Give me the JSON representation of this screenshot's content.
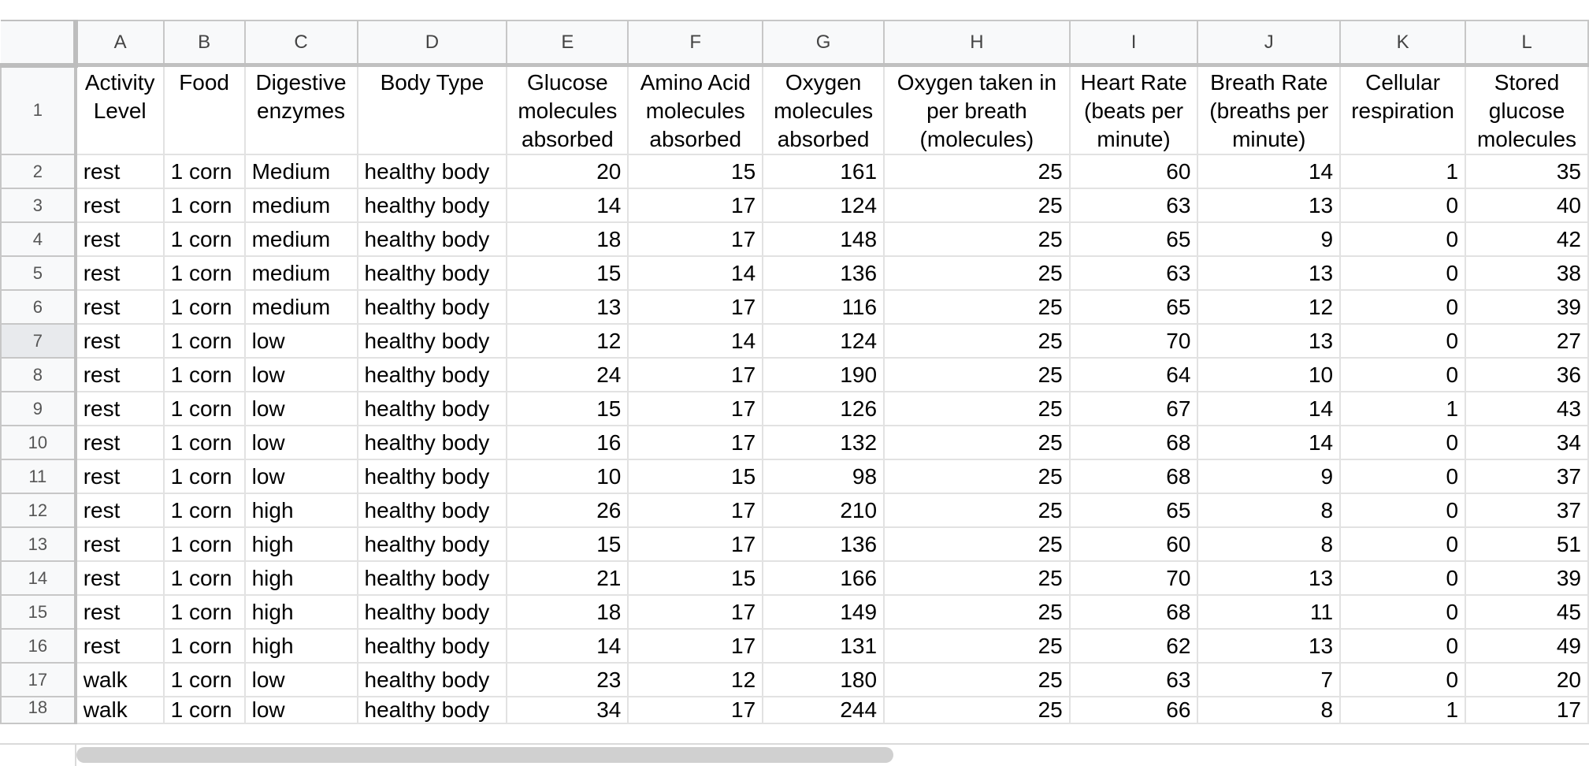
{
  "columns": [
    "A",
    "B",
    "C",
    "D",
    "E",
    "F",
    "G",
    "H",
    "I",
    "J",
    "K",
    "L"
  ],
  "header_row_number": "1",
  "headers": [
    "Activity Level",
    "Food",
    "Digestive enzymes",
    "Body Type",
    "Glucose molecules absorbed",
    "Amino Acid molecules absorbed",
    "Oxygen molecules absorbed",
    "Oxygen taken in per breath (molecules)",
    "Heart Rate (beats per minute)",
    "Breath Rate (breaths per minute)",
    "Cellular respiration",
    "Stored glucose molecules"
  ],
  "rows": [
    {
      "n": "2",
      "cells": [
        "rest",
        "1 corn",
        "Medium",
        "healthy body",
        "20",
        "15",
        "161",
        "25",
        "60",
        "14",
        "1",
        "35"
      ]
    },
    {
      "n": "3",
      "cells": [
        "rest",
        "1 corn",
        "medium",
        "healthy body",
        "14",
        "17",
        "124",
        "25",
        "63",
        "13",
        "0",
        "40"
      ]
    },
    {
      "n": "4",
      "cells": [
        "rest",
        "1 corn",
        "medium",
        "healthy body",
        "18",
        "17",
        "148",
        "25",
        "65",
        "9",
        "0",
        "42"
      ]
    },
    {
      "n": "5",
      "cells": [
        "rest",
        "1 corn",
        "medium",
        "healthy body",
        "15",
        "14",
        "136",
        "25",
        "63",
        "13",
        "0",
        "38"
      ]
    },
    {
      "n": "6",
      "cells": [
        "rest",
        "1 corn",
        "medium",
        "healthy body",
        "13",
        "17",
        "116",
        "25",
        "65",
        "12",
        "0",
        "39"
      ]
    },
    {
      "n": "7",
      "cells": [
        "rest",
        "1 corn",
        "low",
        "healthy body",
        "12",
        "14",
        "124",
        "25",
        "70",
        "13",
        "0",
        "27"
      ]
    },
    {
      "n": "8",
      "cells": [
        "rest",
        "1 corn",
        "low",
        "healthy body",
        "24",
        "17",
        "190",
        "25",
        "64",
        "10",
        "0",
        "36"
      ]
    },
    {
      "n": "9",
      "cells": [
        "rest",
        "1 corn",
        "low",
        "healthy body",
        "15",
        "17",
        "126",
        "25",
        "67",
        "14",
        "1",
        "43"
      ]
    },
    {
      "n": "10",
      "cells": [
        "rest",
        "1 corn",
        "low",
        "healthy body",
        "16",
        "17",
        "132",
        "25",
        "68",
        "14",
        "0",
        "34"
      ]
    },
    {
      "n": "11",
      "cells": [
        "rest",
        "1 corn",
        "low",
        "healthy body",
        "10",
        "15",
        "98",
        "25",
        "68",
        "9",
        "0",
        "37"
      ]
    },
    {
      "n": "12",
      "cells": [
        "rest",
        "1 corn",
        "high",
        "healthy body",
        "26",
        "17",
        "210",
        "25",
        "65",
        "8",
        "0",
        "37"
      ]
    },
    {
      "n": "13",
      "cells": [
        "rest",
        "1 corn",
        "high",
        "healthy body",
        "15",
        "17",
        "136",
        "25",
        "60",
        "8",
        "0",
        "51"
      ]
    },
    {
      "n": "14",
      "cells": [
        "rest",
        "1 corn",
        "high",
        "healthy body",
        "21",
        "15",
        "166",
        "25",
        "70",
        "13",
        "0",
        "39"
      ]
    },
    {
      "n": "15",
      "cells": [
        "rest",
        "1 corn",
        "high",
        "healthy body",
        "18",
        "17",
        "149",
        "25",
        "68",
        "11",
        "0",
        "45"
      ]
    },
    {
      "n": "16",
      "cells": [
        "rest",
        "1 corn",
        "high",
        "healthy body",
        "14",
        "17",
        "131",
        "25",
        "62",
        "13",
        "0",
        "49"
      ]
    },
    {
      "n": "17",
      "cells": [
        "walk",
        "1 corn",
        "low",
        "healthy body",
        "23",
        "12",
        "180",
        "25",
        "63",
        "7",
        "0",
        "20"
      ]
    },
    {
      "n": "18",
      "cells": [
        "walk",
        "1 corn",
        "low",
        "healthy body",
        "34",
        "17",
        "244",
        "25",
        "66",
        "8",
        "1",
        "17"
      ]
    }
  ],
  "selected_row": "7",
  "numeric_columns_from": 4
}
